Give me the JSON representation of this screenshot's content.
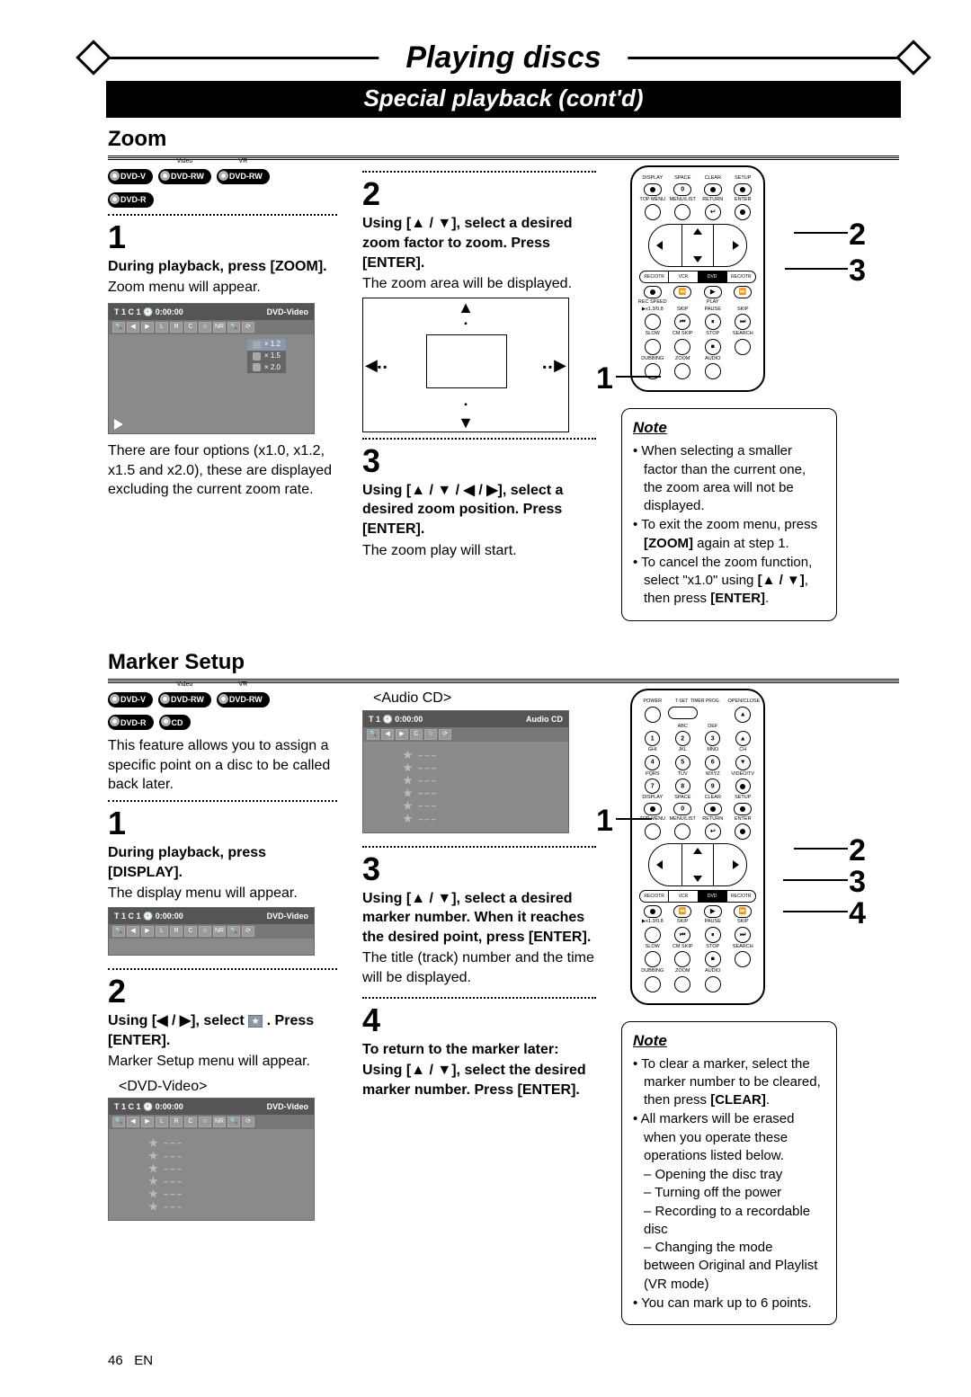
{
  "header": {
    "title": "Playing discs",
    "section": "Special playback (cont'd)"
  },
  "zoom": {
    "heading": "Zoom",
    "discs": [
      "DVD-V",
      "DVD-RW",
      "DVD-RW",
      "DVD-R"
    ],
    "disc_tops": [
      "",
      "Video",
      "VR",
      ""
    ],
    "step1": {
      "num": "1",
      "bold": "During playback, press [ZOOM].",
      "text": "Zoom menu will appear.",
      "osd_left": "T  1  C 1   🕘 0:00:00",
      "osd_right": "DVD-Video",
      "zoom_opts": [
        "× 1.2",
        "× 1.5",
        "× 2.0"
      ],
      "after": "There are four options (x1.0, x1.2, x1.5 and x2.0), these are displayed excluding the current zoom rate."
    },
    "step2": {
      "num": "2",
      "bold": "Using [▲ / ▼], select a desired zoom factor to zoom. Press [ENTER].",
      "text": "The zoom area will be displayed."
    },
    "step3": {
      "num": "3",
      "bold": "Using [▲ / ▼ / ◀ / ▶], select a desired zoom position. Press [ENTER].",
      "text": "The zoom play will start."
    },
    "note": {
      "title": "Note",
      "items": [
        "When selecting a smaller factor than the current one, the zoom area will not be displayed.",
        "To exit the zoom menu, press [ZOOM] again at step 1.",
        "To cancel the zoom function, select \"x1.0\" using [▲ / ▼], then press [ENTER]."
      ]
    },
    "callouts": {
      "left": "1",
      "r1": "2",
      "r2": "3"
    }
  },
  "marker": {
    "heading": "Marker Setup",
    "discs": [
      "DVD-V",
      "DVD-RW",
      "DVD-RW",
      "DVD-R",
      "CD"
    ],
    "disc_tops": [
      "",
      "Video",
      "VR",
      "",
      ""
    ],
    "intro": "This feature allows you to assign a specific point on a disc to be called back later.",
    "step1": {
      "num": "1",
      "bold": "During playback, press [DISPLAY].",
      "text": "The display menu will appear.",
      "osd_left": "T  1  C 1   🕘 0:00:00",
      "osd_right": "DVD-Video"
    },
    "step2": {
      "num": "2",
      "bold_a": "Using [◀ / ▶], select ",
      "bold_b": " . Press [ENTER].",
      "text": "Marker Setup menu will appear.",
      "caption": "<DVD-Video>",
      "osd_left": "T  1  C 1   🕘 0:00:00",
      "osd_right": "DVD-Video"
    },
    "audio": {
      "caption": "<Audio CD>",
      "osd_left": "T  1   🕘 0:00:00",
      "osd_right": "Audio CD"
    },
    "step3": {
      "num": "3",
      "bold": "Using [▲ / ▼], select a desired marker number. When it reaches the desired point, press [ENTER].",
      "text": "The title (track) number and the time will be displayed."
    },
    "step4": {
      "num": "4",
      "bold1": "To return to the marker later:",
      "bold2": "Using [▲ / ▼], select the desired marker number. Press [ENTER]."
    },
    "note": {
      "title": "Note",
      "i1": "To clear a marker, select the marker number to be cleared, then press [CLEAR].",
      "i2": "All markers will be erased when you operate these operations listed below.",
      "d1": "Opening the disc tray",
      "d2": "Turning off the power",
      "d3": "Recording to a recordable disc",
      "d4": "Changing the mode between Original and Playlist (VR mode)",
      "i3": "You can mark up to 6 points."
    },
    "callouts": {
      "left": "1",
      "r1": "2",
      "r2": "3",
      "r3": "4"
    }
  },
  "remote": {
    "row1_lbl": [
      "DISPLAY",
      "SPACE",
      "CLEAR",
      "SETUP"
    ],
    "row2_lbl": [
      "TOP MENU",
      "MENU/LIST",
      "RETURN",
      "ENTER"
    ],
    "mode": [
      "REC/OTR",
      "VCR",
      "DVD",
      "REC/OTR"
    ],
    "row3_lbl": [
      "REC SPEED",
      "",
      "PLAY",
      ""
    ],
    "row4_lbl": [
      "▶x1.3/0.8",
      "SKIP",
      "PAUSE",
      "SKIP"
    ],
    "row5_lbl": [
      "SLOW",
      "CM SKIP",
      "STOP",
      "SEARCH"
    ],
    "row6_lbl": [
      "DUBBING",
      "ZOOM",
      "AUDIO",
      ""
    ],
    "top_lbl": [
      "POWER",
      "T-SET",
      "TIMER PROG.",
      "OPEN/CLOSE"
    ],
    "key_lbl": [
      [
        "",
        "ABC",
        "DEF",
        ""
      ],
      [
        "GHI",
        "JKL",
        "MNO",
        "CH"
      ],
      [
        "PQRS",
        "TUV",
        "WXYZ",
        "VIDEO/TV"
      ],
      [
        "DISPLAY",
        "SPACE",
        "CLEAR",
        "SETUP"
      ]
    ],
    "key_num": [
      [
        "1",
        "2",
        "3",
        "▲"
      ],
      [
        "4",
        "5",
        "6",
        "▼"
      ],
      [
        "7",
        "8",
        "9",
        ""
      ],
      [
        "",
        "0",
        "",
        ""
      ]
    ]
  },
  "marker_rows": [
    "– – –",
    "– – –",
    "– – –",
    "– – –",
    "– – –",
    "– – –"
  ],
  "footer": {
    "page": "46",
    "lang": "EN"
  }
}
